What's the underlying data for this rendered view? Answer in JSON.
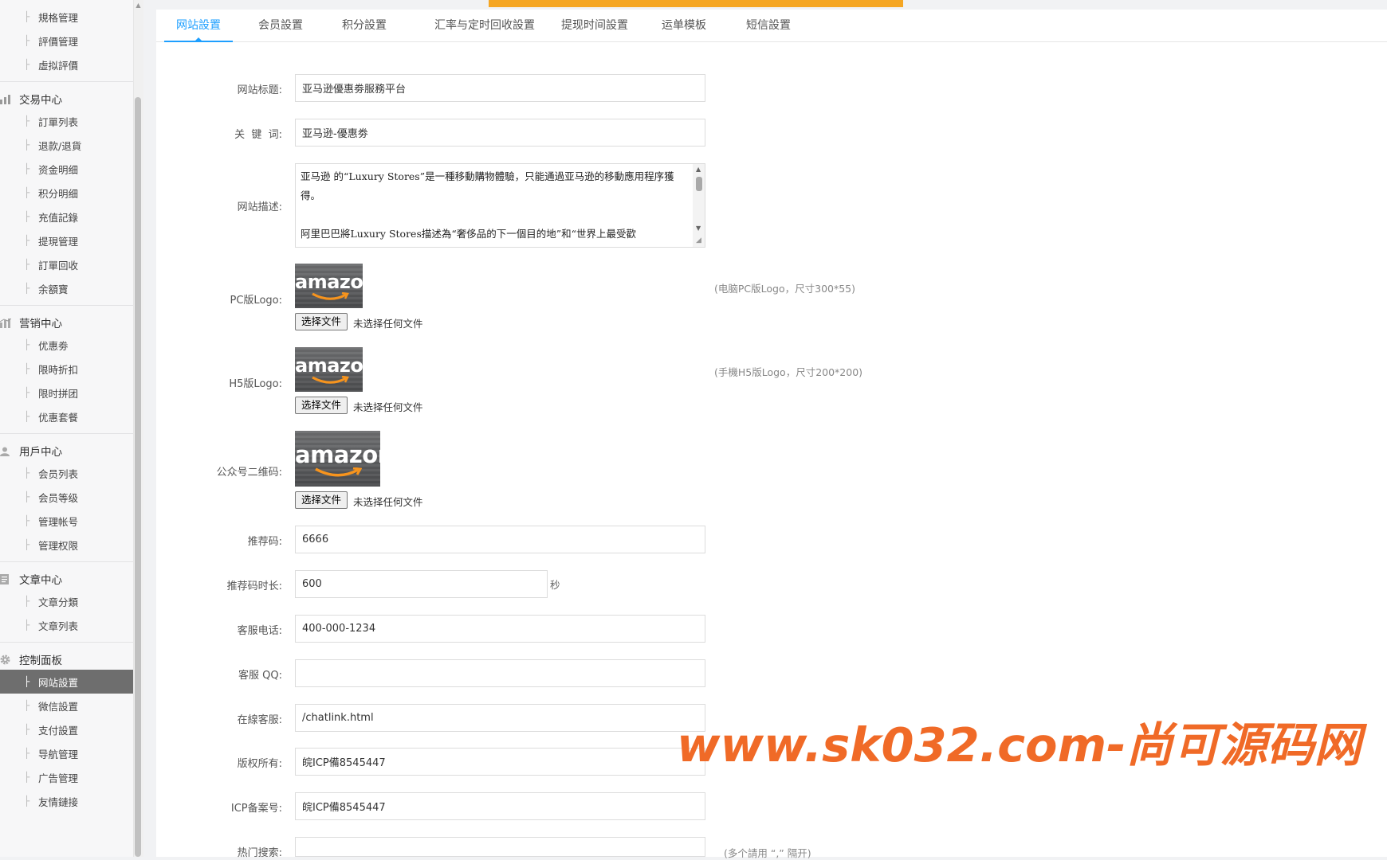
{
  "sidebar": {
    "groups": [
      {
        "title": "",
        "icon": "",
        "items": [
          {
            "label": "規格管理"
          },
          {
            "label": "評價管理"
          },
          {
            "label": "虛拟評價"
          }
        ]
      },
      {
        "title": "交易中心",
        "icon": "bar-chart-icon",
        "items": [
          {
            "label": "訂單列表"
          },
          {
            "label": "退款/退貨"
          },
          {
            "label": "资金明细"
          },
          {
            "label": "积分明细"
          },
          {
            "label": "充值記錄"
          },
          {
            "label": "提現管理"
          },
          {
            "label": "訂單回收"
          },
          {
            "label": "余額寶"
          }
        ]
      },
      {
        "title": "营销中心",
        "icon": "bar-chart-icon",
        "items": [
          {
            "label": "优惠劵"
          },
          {
            "label": "限時折扣"
          },
          {
            "label": "限时拼团"
          },
          {
            "label": "优惠套餐"
          }
        ]
      },
      {
        "title": "用戶中心",
        "icon": "user-icon",
        "items": [
          {
            "label": "会员列表"
          },
          {
            "label": "会员等级"
          },
          {
            "label": "管理帐号"
          },
          {
            "label": "管理权限"
          }
        ]
      },
      {
        "title": "文章中心",
        "icon": "document-icon",
        "items": [
          {
            "label": "文章分類"
          },
          {
            "label": "文章列表"
          }
        ]
      },
      {
        "title": "控制面板",
        "icon": "gear-icon",
        "items": [
          {
            "label": "网站設置",
            "active": true
          },
          {
            "label": "微信設置"
          },
          {
            "label": "支付設置"
          },
          {
            "label": "导航管理"
          },
          {
            "label": "广告管理"
          },
          {
            "label": "友情鏈接"
          }
        ]
      }
    ]
  },
  "tabs": [
    {
      "label": "网站設置",
      "active": true
    },
    {
      "label": "会员設置"
    },
    {
      "label": "积分設置"
    },
    {
      "label": "汇率与定时回收設置"
    },
    {
      "label": "提现时间設置"
    },
    {
      "label": "运单模板"
    },
    {
      "label": "短信設置"
    }
  ],
  "form": {
    "site_title": {
      "label": "网站标题:",
      "value": "亚马逊優惠劵服務平台"
    },
    "keywords": {
      "label": "关  键  词:",
      "value": "亚马逊-優惠劵"
    },
    "description": {
      "label": "网站描述:",
      "value": "亚马逊 的“Luxury Stores”是一種移動購物體驗，只能通過亚马逊的移動應用程序獲得。\n\n阿里巴巴將Luxury Stores描述為“奢侈品的下一個目的地”和“世界上最受歡"
    },
    "pc_logo": {
      "label": "PC版Logo:",
      "logo_text": "amazon",
      "button": "选择文件",
      "status": "未选择任何文件",
      "hint": "(电脑PC版Logo，尺寸300*55)"
    },
    "h5_logo": {
      "label": "H5版Logo:",
      "logo_text": "amazon",
      "button": "选择文件",
      "status": "未选择任何文件",
      "hint": "(手機H5版Logo，尺寸200*200)"
    },
    "qrcode": {
      "label": "公众号二维码:",
      "logo_text": "amazon",
      "button": "选择文件",
      "status": "未选择任何文件"
    },
    "ref_code": {
      "label": "推荐码:",
      "value": "6666"
    },
    "ref_duration": {
      "label": "推荐码时长:",
      "value": "600",
      "suffix": "秒"
    },
    "phone": {
      "label": "客服电话:",
      "value": "400-000-1234"
    },
    "qq": {
      "label": "客服 QQ:",
      "value": ""
    },
    "online_service": {
      "label": "在線客服:",
      "value": "/chatlink.html"
    },
    "copyright": {
      "label": "版权所有:",
      "value": "皖ICP備8545447"
    },
    "icp": {
      "label": "ICP备案号:",
      "value": "皖ICP備8545447"
    },
    "hot_search": {
      "label": "热门搜索:",
      "value": "",
      "hint": "(多个請用 “,” 隔开)"
    }
  },
  "watermark": "www.sk032.com-尚可源码网"
}
